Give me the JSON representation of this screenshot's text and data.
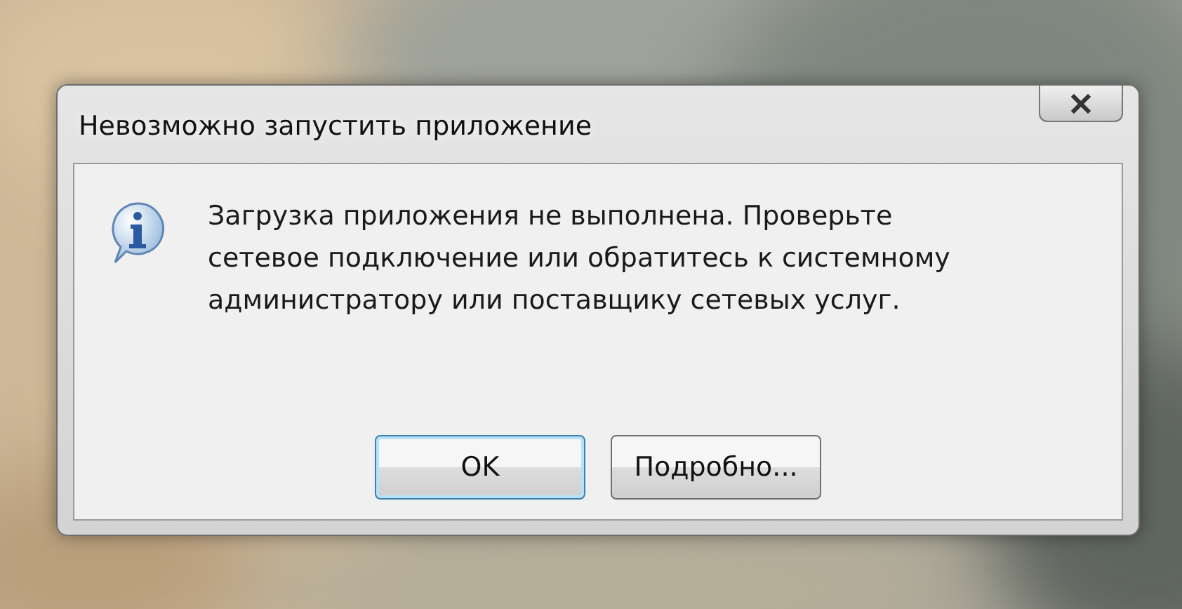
{
  "window": {
    "title": "Невозможно запустить приложение"
  },
  "message": "Загрузка приложения не выполнена. Проверьте сетевое подключение или обратитесь к системному администратору или поставщику сетевых услуг.",
  "buttons": [
    {
      "label": "OK",
      "default": true
    },
    {
      "label": "Подробно...",
      "default": false
    }
  ]
}
